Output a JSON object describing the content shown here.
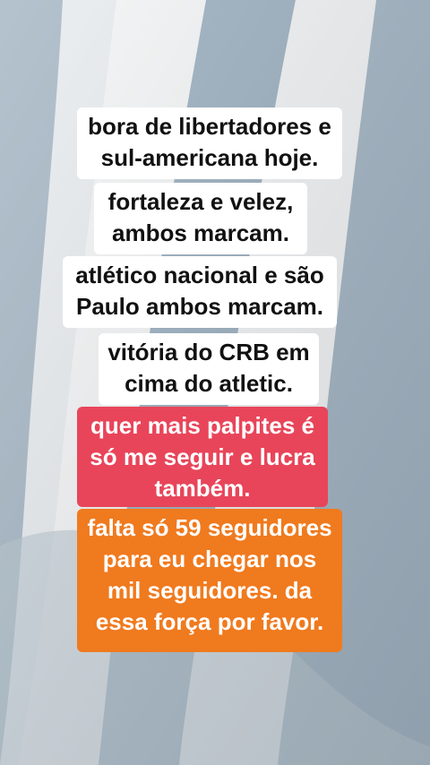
{
  "captions": [
    {
      "lines": [
        "bora de libertadores e",
        "sul-americana hoje."
      ],
      "style": "white"
    },
    {
      "lines": [
        "fortaleza e velez,",
        "ambos marcam."
      ],
      "style": "white"
    },
    {
      "lines": [
        "atlético nacional e são",
        "Paulo ambos marcam."
      ],
      "style": "white"
    },
    {
      "lines": [
        "vitória do CRB em",
        "cima do atletic."
      ],
      "style": "white"
    },
    {
      "lines": [
        "quer mais palpites é",
        "só me seguir e lucra",
        "também."
      ],
      "style": "red"
    },
    {
      "lines": [
        "falta só 59 seguidores",
        "para eu chegar nos",
        "mil seguidores. da",
        "essa força por favor."
      ],
      "style": "orange"
    }
  ],
  "colors": {
    "caption_white": "#ffffff",
    "caption_red": "#e8455a",
    "caption_orange": "#f07a1e",
    "stripe_blue": "#9fb2c2",
    "stripe_white": "#f2f4f5"
  }
}
